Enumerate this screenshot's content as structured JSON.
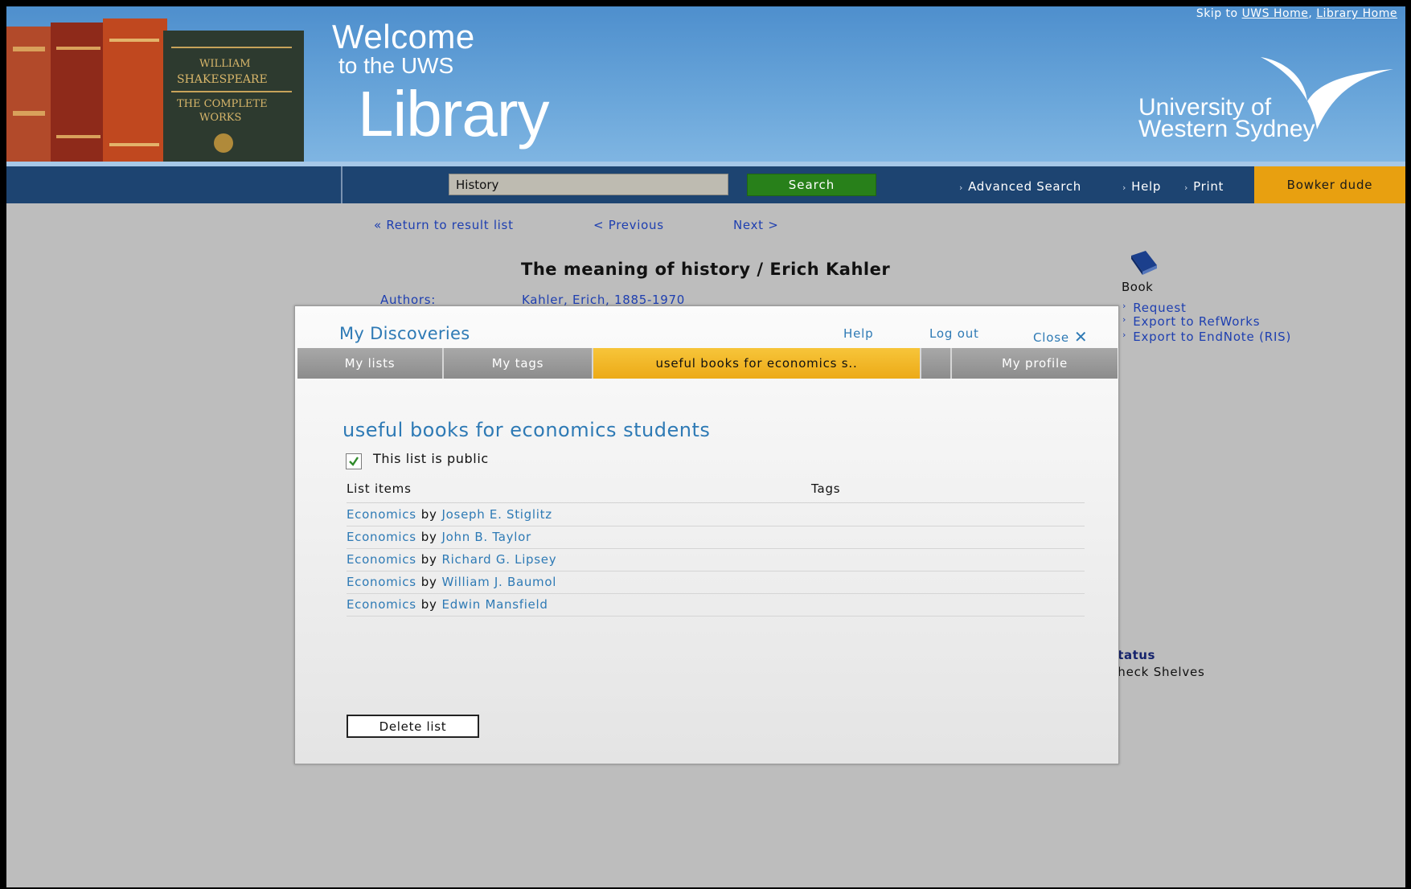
{
  "header": {
    "welcome_line1": "Welcome",
    "welcome_line2": "to the UWS",
    "welcome_line3": "Library",
    "skip_prefix": "Skip to",
    "skip_link1": "UWS Home",
    "skip_sep": ",",
    "skip_link2": "Library Home",
    "university_line1": "University of",
    "university_line2": "Western Sydney"
  },
  "navbar": {
    "search_value": "History",
    "search_button": "Search",
    "advanced_search": "Advanced Search",
    "help": "Help",
    "print": "Print",
    "user": "Bowker dude"
  },
  "record_nav": {
    "return": "« Return to result list",
    "previous": "< Previous",
    "next": "Next >"
  },
  "record": {
    "title": "The meaning of history / Erich Kahler",
    "authors_label": "Authors:",
    "authors_value": "Kahler, Erich, 1885-1970",
    "format": "Book",
    "actions": [
      "Request",
      "Export to RefWorks",
      "Export to EndNote (RIS)"
    ],
    "status_label": "Status",
    "status_value": "Check Shelves"
  },
  "modal": {
    "title": "My Discoveries",
    "help": "Help",
    "logout": "Log out",
    "close": "Close",
    "tabs": {
      "lists": "My lists",
      "tags": "My tags",
      "active": "useful books for economics s..",
      "profile": "My profile"
    },
    "list_title": "useful books for economics students",
    "public_label": "This list is public",
    "public_checked": true,
    "col_items": "List items",
    "col_tags": "Tags",
    "items": [
      {
        "title": "Economics",
        "by": "by",
        "author": "Joseph E. Stiglitz"
      },
      {
        "title": "Economics",
        "by": "by",
        "author": "John B. Taylor"
      },
      {
        "title": "Economics",
        "by": "by",
        "author": "Richard G. Lipsey"
      },
      {
        "title": "Economics",
        "by": "by",
        "author": "William J. Baumol"
      },
      {
        "title": "Economics",
        "by": "by",
        "author": "Edwin Mansfield"
      }
    ],
    "delete_button": "Delete list"
  },
  "colors": {
    "navbar": "#1d4471",
    "search_button": "#28801a",
    "user_box": "#e8a010",
    "active_tab": "#f0b52a",
    "link_blue": "#2e7ab5"
  }
}
